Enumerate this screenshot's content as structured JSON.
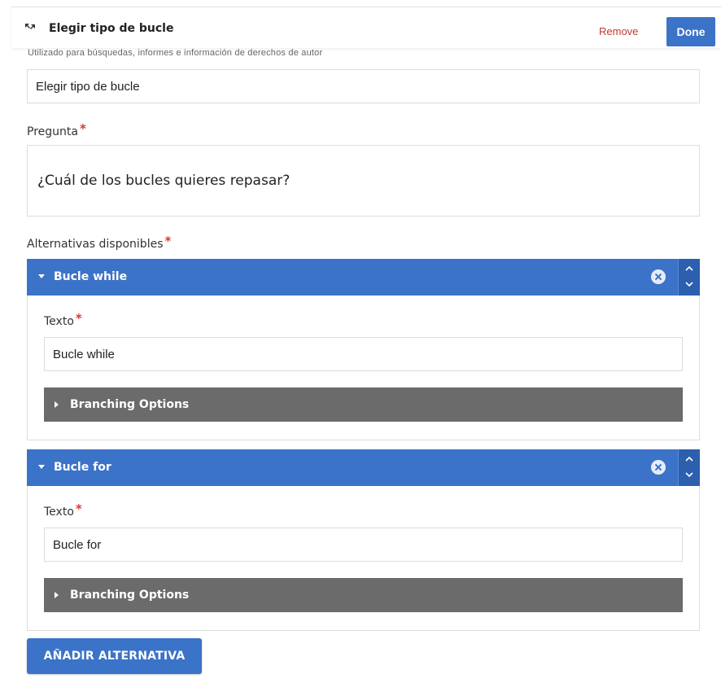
{
  "header": {
    "title": "Elegir tipo de bucle",
    "remove_label": "Remove",
    "done_label": "Done",
    "collapse_icon": "collapse-arrows-icon"
  },
  "metadata": {
    "description": "Utilizado para búsquedas, informes e información de derechos de autor",
    "value": "Elegir tipo de bucle"
  },
  "question": {
    "label": "Pregunta",
    "required_mark": "*",
    "value": "¿Cuál de los bucles quieres repasar?"
  },
  "alternatives": {
    "label": "Alternativas disponibles",
    "required_mark": "*",
    "items": [
      {
        "title": "Bucle while",
        "text_label": "Texto",
        "required_mark": "*",
        "text_value": "Bucle while",
        "branching_label": "Branching Options"
      },
      {
        "title": "Bucle for",
        "text_label": "Texto",
        "required_mark": "*",
        "text_value": "Bucle for",
        "branching_label": "Branching Options"
      }
    ],
    "add_button_label": "AÑADIR ALTERNATIVA"
  },
  "colors": {
    "accent": "#3b73c8",
    "remove": "#c0392b",
    "branching_bar": "#6b6b6b",
    "required": "#d63b2f"
  }
}
